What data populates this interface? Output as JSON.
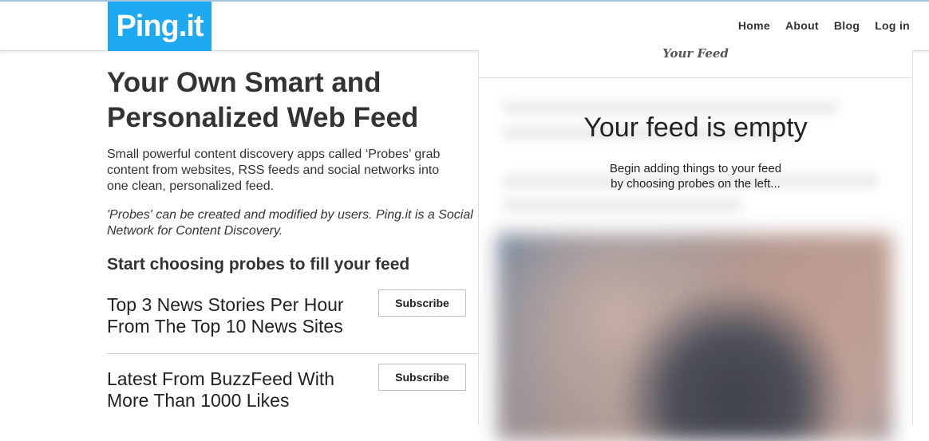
{
  "header": {
    "logo_text": "Ping.it",
    "nav": [
      {
        "label": "Home"
      },
      {
        "label": "About"
      },
      {
        "label": "Blog"
      },
      {
        "label": "Log in"
      }
    ]
  },
  "hero": {
    "title": "Your Own Smart and Personalized Web Feed",
    "description": "Small powerful content discovery apps called ‘Probes’ grab content from websites, RSS feeds and social networks into one clean, personalized feed.",
    "description_italic": "'Probes' can be created and modified by users. Ping.it is a Social Network for Content Discovery.",
    "start_heading": "Start choosing probes to fill your feed"
  },
  "probes": [
    {
      "title": "Top 3 News Stories Per Hour From The Top 10 News Sites",
      "button_label": "Subscribe"
    },
    {
      "title": "Latest From BuzzFeed With More Than 1000 Likes",
      "button_label": "Subscribe"
    }
  ],
  "feed": {
    "header": "Your Feed",
    "empty_title": "Your feed is empty",
    "empty_line1": "Begin adding things to your feed",
    "empty_line2": "by choosing probes on the left..."
  },
  "colors": {
    "brand": "#1eaaf1"
  }
}
